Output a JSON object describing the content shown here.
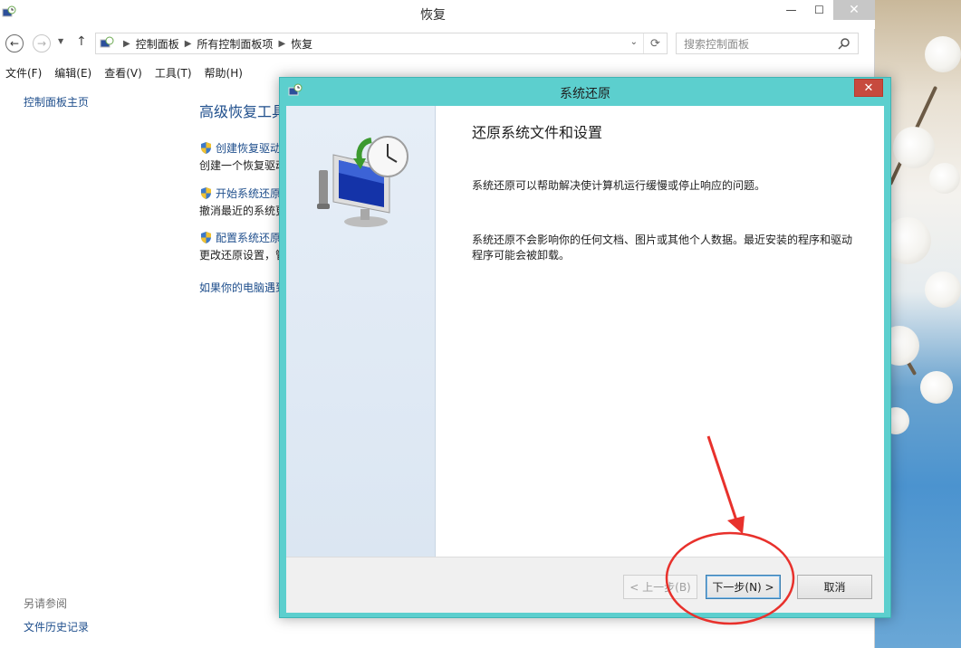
{
  "window": {
    "title": "恢复",
    "minimize": "—",
    "maximize": "☐",
    "close": "✕"
  },
  "nav": {
    "back": "←",
    "forward": "→",
    "history_dropdown": "▼",
    "up": "↑",
    "breadcrumbs": [
      "控制面板",
      "所有控制面板项",
      "恢复"
    ],
    "address_dropdown": "⌄",
    "refresh": "⟳",
    "search_placeholder": "搜索控制面板"
  },
  "menu": [
    "文件(F)",
    "编辑(E)",
    "查看(V)",
    "工具(T)",
    "帮助(H)"
  ],
  "sidebar": {
    "home": "控制面板主页",
    "see_also_label": "另请参阅",
    "file_history": "文件历史记录"
  },
  "content": {
    "title": "高级恢复工具",
    "tasks": [
      {
        "link": "创建恢复驱动器",
        "desc": "创建一个恢复驱动器"
      },
      {
        "link": "开始系统还原",
        "desc": "撤消最近的系统更改"
      },
      {
        "link": "配置系统还原",
        "desc": "更改还原设置，管理磁盘空间"
      }
    ],
    "extra_link": "如果你的电脑遇到问题"
  },
  "dialog": {
    "title": "系统还原",
    "close": "✕",
    "heading": "还原系统文件和设置",
    "para1": "系统还原可以帮助解决使计算机运行缓慢或停止响应的问题。",
    "para2": "系统还原不会影响你的任何文档、图片或其他个人数据。最近安装的程序和驱动程序可能会被卸载。",
    "buttons": {
      "back": "< 上一步(B)",
      "next": "下一步(N) >",
      "cancel": "取消"
    }
  },
  "colors": {
    "dialog_frame": "#5ccfce",
    "link": "#1e4e8c",
    "dialog_close": "#c74a3e",
    "annotation": "#e8312c"
  }
}
